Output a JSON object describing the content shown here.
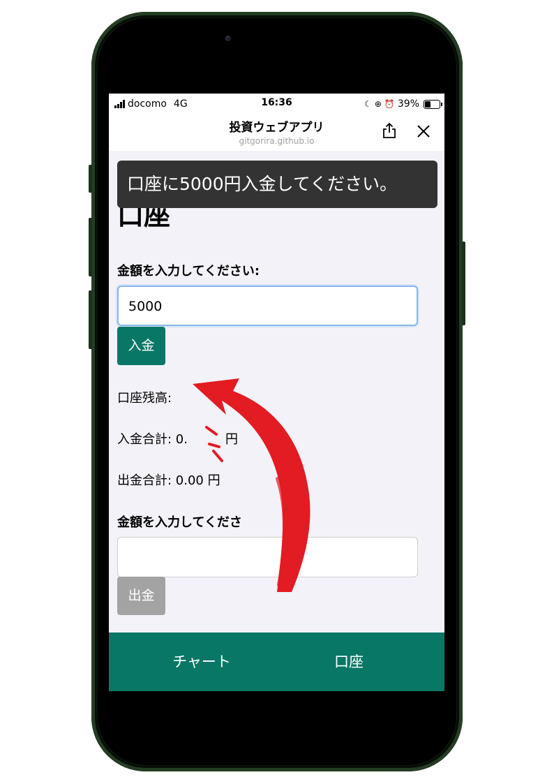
{
  "status_bar": {
    "carrier": "docomo",
    "network": "4G",
    "time": "16:36",
    "battery": "39%",
    "battery_level": 0.39
  },
  "browser": {
    "title": "投資ウェブアプリ",
    "url": "gitgorira.github.io",
    "share_icon": "share-icon",
    "close_icon": "close-icon"
  },
  "toast": {
    "message": "口座に5000円入金してください。"
  },
  "account": {
    "heading": "口座",
    "deposit_label": "金額を入力してください:",
    "deposit_value": "5000",
    "deposit_button": "入金",
    "balance": "口座残高:",
    "total_deposit": "入金合計: 0.",
    "total_deposit_tail": "円",
    "total_withdraw": "出金合計: 0.00 円",
    "withdraw_label": "金額を入力してくださ",
    "withdraw_value": "",
    "withdraw_button": "出金"
  },
  "tabs": [
    "チャート",
    "口座"
  ],
  "colors": {
    "accent": "#087766",
    "toast_bg": "#333333",
    "arrow": "#e31b23",
    "disabled": "#a3a3a3"
  }
}
